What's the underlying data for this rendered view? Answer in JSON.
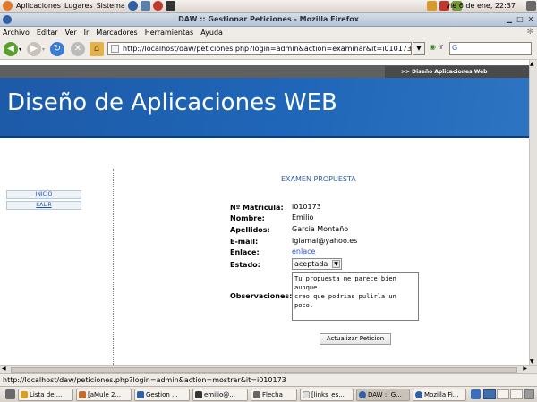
{
  "top_panel": {
    "menus": [
      "Aplicaciones",
      "Lugares",
      "Sistema"
    ],
    "clock": "vie  6 de ene, 22:37"
  },
  "window": {
    "title": "DAW :: Gestionar Peticiones - Mozilla Firefox"
  },
  "menubar": {
    "items": [
      "Archivo",
      "Editar",
      "Ver",
      "Ir",
      "Marcadores",
      "Herramientas",
      "Ayuda"
    ]
  },
  "navbar": {
    "url": "http://localhost/daw/peticiones.php?login=admin&action=examinar&it=i010173",
    "go_label": "Ir"
  },
  "page": {
    "top_tab": ">> Diseño Aplicaciones Web",
    "site_title": "Diseño de Aplicaciones WEB",
    "sidebar": [
      "INICIO",
      "SALIR"
    ],
    "section_title": "EXAMEN PROPUESTA",
    "fields": {
      "matricula_label": "Nº Matricula:",
      "matricula_value": "i010173",
      "nombre_label": "Nombre:",
      "nombre_value": "Emilio",
      "apellidos_label": "Apellidos:",
      "apellidos_value": "Garcia Montaño",
      "email_label": "E-mail:",
      "email_value": "igiamai@yahoo.es",
      "enlace_label": "Enlace:",
      "enlace_value": "enlace",
      "estado_label": "Estado:",
      "estado_value": "aceptada",
      "observaciones_label": "Observaciones:",
      "observaciones_value": "Tu propuesta me parece bien aunque\ncreo que podrias pulirla un poco."
    },
    "submit_label": "Actualizar Peticion"
  },
  "statusbar": {
    "text": "http://localhost/daw/peticiones.php?login=admin&action=mostrar&it=i010173"
  },
  "taskbar": {
    "tasks": [
      "Lista de ...",
      "[aMule 2...",
      "Gestion ...",
      "emilio@...",
      "Flecha",
      "[links_es...",
      "DAW :: G...",
      "Mozilla Fi..."
    ]
  }
}
